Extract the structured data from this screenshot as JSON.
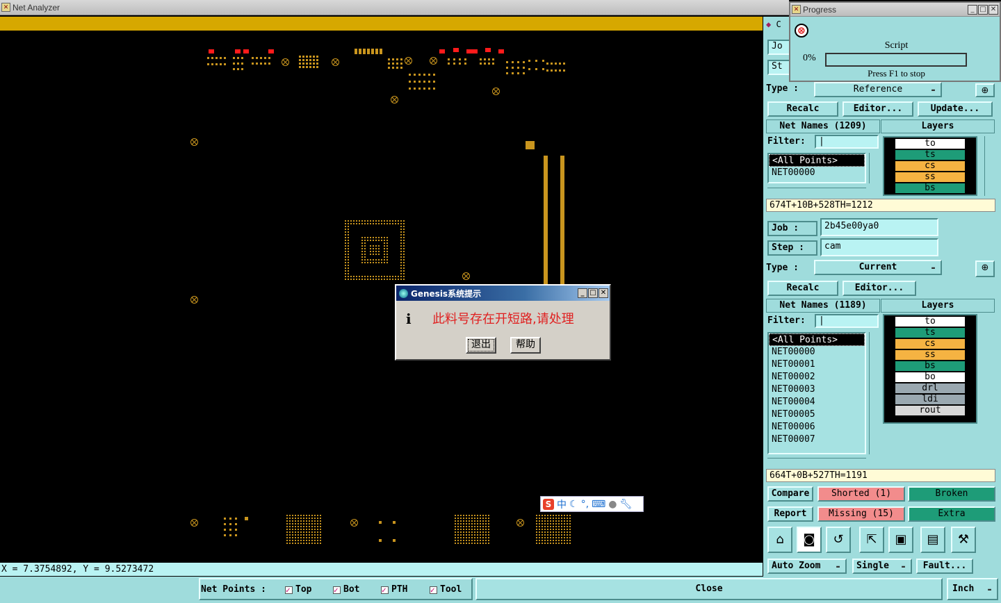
{
  "main_window": {
    "title": "Net Analyzer"
  },
  "canvas": {
    "bar_color": "#d6a800",
    "pad_color": "#c9951e",
    "highlight_color": "#ff1b1b"
  },
  "coords": "X = 7.3754892, Y = 9.5273472",
  "progress": {
    "title": "Progress",
    "label": "Script",
    "percent": "0%",
    "fraction": 0,
    "hint": "Press F1 to stop"
  },
  "panel_top": {
    "job_label": "Jo",
    "step_label": "St",
    "type_label": "Type  :",
    "type_value": "Reference",
    "recalc": "Recalc",
    "editor": "Editor...",
    "update": "Update...",
    "net_names": "Net Names (1209)",
    "layers_header": "Layers",
    "filter_label": "Filter:",
    "items": [
      "<All Points>",
      "NET00000"
    ],
    "layers": [
      {
        "name": "to",
        "color": "#ffffff"
      },
      {
        "name": "ts",
        "color": "#1e9c78"
      },
      {
        "name": "cs",
        "color": "#f5b342"
      },
      {
        "name": "ss",
        "color": "#f5b342"
      },
      {
        "name": "bs",
        "color": "#1e9c78"
      }
    ],
    "summary": "674T+10B+528TH=1212"
  },
  "panel_bottom": {
    "job_label": "Job   :",
    "job_value": "2b45e00ya0",
    "step_label": "Step  :",
    "step_value": "cam",
    "type_label": "Type  :",
    "type_value": "Current",
    "recalc": "Recalc",
    "editor": "Editor...",
    "net_names": "Net Names (1189)",
    "layers_header": "Layers",
    "filter_label": "Filter:",
    "items": [
      "<All Points>",
      "NET00000",
      "NET00001",
      "NET00002",
      "NET00003",
      "NET00004",
      "NET00005",
      "NET00006",
      "NET00007"
    ],
    "layers": [
      {
        "name": "to",
        "color": "#ffffff"
      },
      {
        "name": "ts",
        "color": "#1e9c78"
      },
      {
        "name": "cs",
        "color": "#f5b342"
      },
      {
        "name": "ss",
        "color": "#f5b342"
      },
      {
        "name": "bs",
        "color": "#1e9c78"
      },
      {
        "name": "bo",
        "color": "#ffffff"
      },
      {
        "name": "drl",
        "color": "#9aa8b0"
      },
      {
        "name": "ldi",
        "color": "#9aa8b0"
      },
      {
        "name": "rout",
        "color": "#d8d8d8"
      }
    ],
    "summary": "664T+0B+527TH=1191"
  },
  "results": {
    "compare": "Compare",
    "shorted": "Shorted (1)",
    "broken": "Broken",
    "report": "Report",
    "missing": "Missing (15)",
    "extra": "Extra",
    "auto_zoom": "Auto Zoom",
    "single": "Single",
    "fault": "Fault...",
    "error_color": "#f28c8c",
    "ok_color": "#1e9c78"
  },
  "bottom": {
    "net_points": "Net Points :",
    "top": "Top",
    "bot": "Bot",
    "pth": "PTH",
    "tool": "Tool",
    "close": "Close",
    "units": "Inch"
  },
  "dialog": {
    "title": "Genesis系统提示",
    "message": "此料号存在开短路,请处理",
    "exit": "退出",
    "help": "帮助"
  },
  "ime": {
    "lang": "中"
  }
}
